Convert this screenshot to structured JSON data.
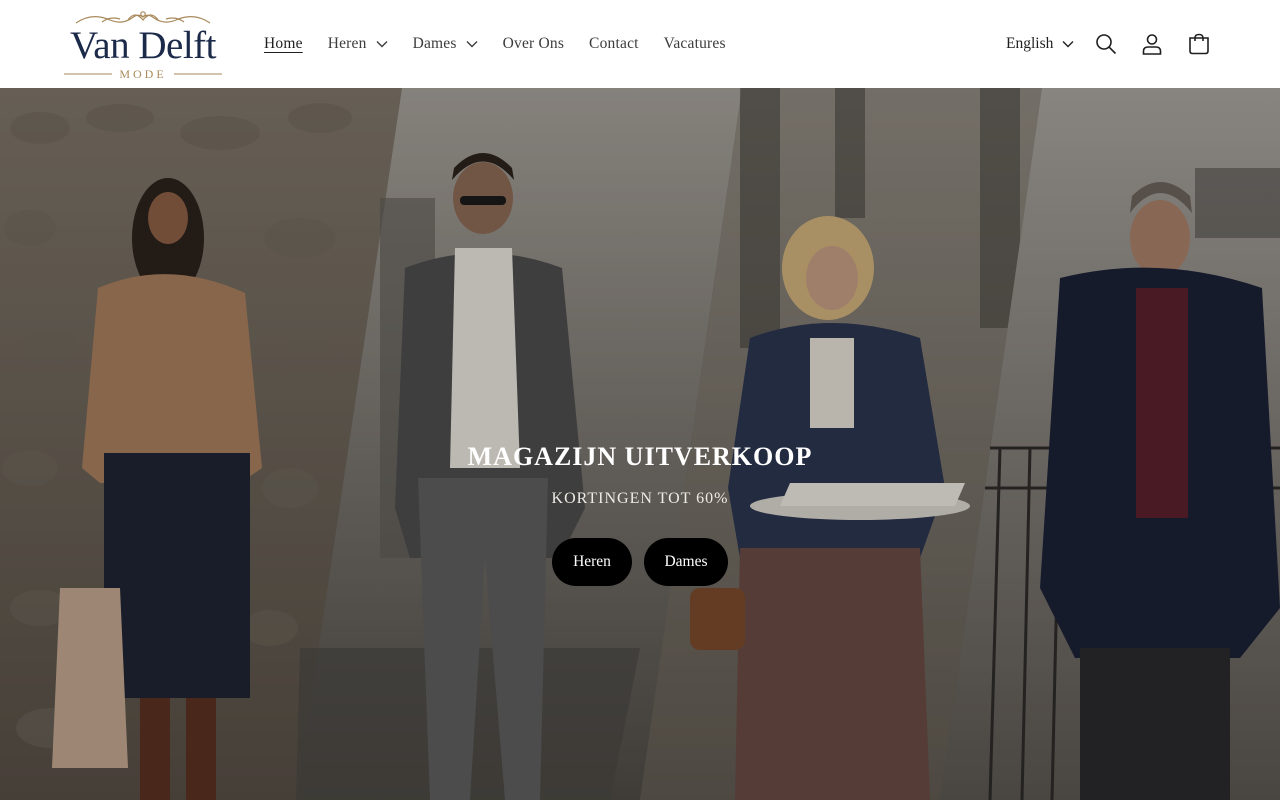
{
  "brand": {
    "name": "Van Delft",
    "tagline": "MODE"
  },
  "nav": {
    "items": [
      {
        "label": "Home",
        "active": true,
        "has_dropdown": false
      },
      {
        "label": "Heren",
        "active": false,
        "has_dropdown": true
      },
      {
        "label": "Dames",
        "active": false,
        "has_dropdown": true
      },
      {
        "label": "Over Ons",
        "active": false,
        "has_dropdown": false
      },
      {
        "label": "Contact",
        "active": false,
        "has_dropdown": false
      },
      {
        "label": "Vacatures",
        "active": false,
        "has_dropdown": false
      }
    ]
  },
  "header_actions": {
    "language": "English",
    "icons": [
      "search-icon",
      "account-icon",
      "cart-icon"
    ]
  },
  "hero": {
    "title": "MAGAZIJN UITVERKOOP",
    "subtitle": "KORTINGEN TOT 60%",
    "buttons": [
      {
        "label": "Heren"
      },
      {
        "label": "Dames"
      }
    ]
  },
  "colors": {
    "brand_navy": "#1c2a4a",
    "brand_gold": "#a98a5c",
    "button_bg": "#000000",
    "button_text": "#ffffff"
  }
}
